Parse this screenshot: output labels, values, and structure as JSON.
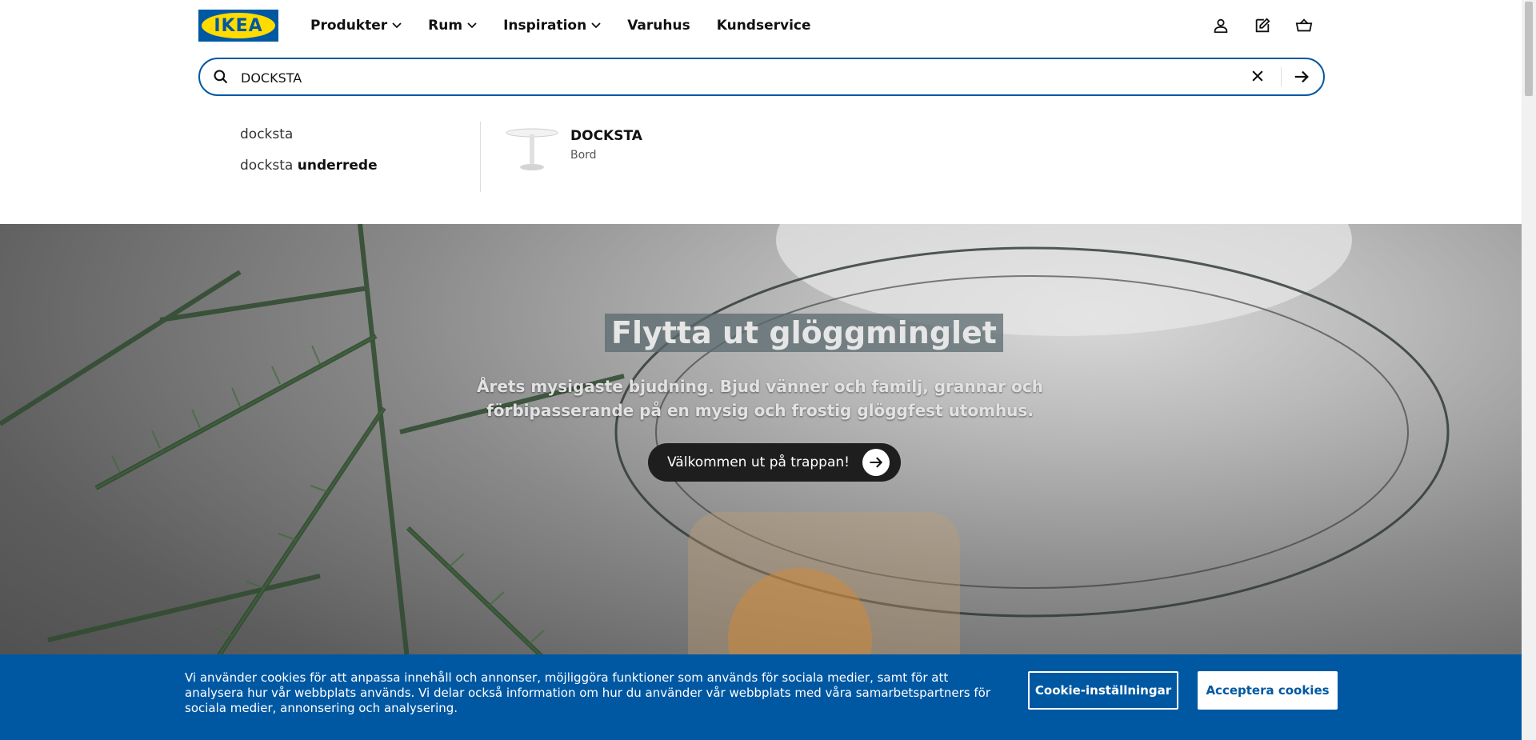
{
  "header": {
    "logo_text": "IKEA",
    "nav": [
      {
        "label": "Produkter",
        "has_dropdown": true
      },
      {
        "label": "Rum",
        "has_dropdown": true
      },
      {
        "label": "Inspiration",
        "has_dropdown": true
      },
      {
        "label": "Varuhus",
        "has_dropdown": false
      },
      {
        "label": "Kundservice",
        "has_dropdown": false
      }
    ],
    "icons": [
      "user-icon",
      "shopping-list-icon",
      "cart-icon"
    ]
  },
  "search": {
    "value": "DOCKSTA",
    "icon": "search-icon",
    "clear_icon": "close-icon",
    "submit_icon": "arrow-right-icon"
  },
  "suggestions": [
    {
      "plain": "docksta",
      "bold": ""
    },
    {
      "plain": "docksta ",
      "bold": "underrede"
    }
  ],
  "product_result": {
    "name": "DOCKSTA",
    "type": "Bord"
  },
  "hero": {
    "title": "Flytta ut glöggminglet",
    "subtitle": "Årets mysigaste bjudning. Bjud vänner och familj, grannar och förbipasserande på en mysig och frostig glöggfest utomhus.",
    "button_label": "Välkommen ut på trappan!"
  },
  "cookie_banner": {
    "text": "Vi använder cookies för att anpassa innehåll och annonser, möjliggöra funktioner som används för sociala medier, samt för att analysera hur vår webbplats används. Vi delar också information om hur du använder vår webbplats med våra samarbetspartners för sociala medier, annonsering och analysering.",
    "settings_label": "Cookie-inställningar",
    "accept_label": "Acceptera cookies"
  },
  "colors": {
    "brand_blue": "#0058a3",
    "brand_yellow": "#ffdb00"
  }
}
